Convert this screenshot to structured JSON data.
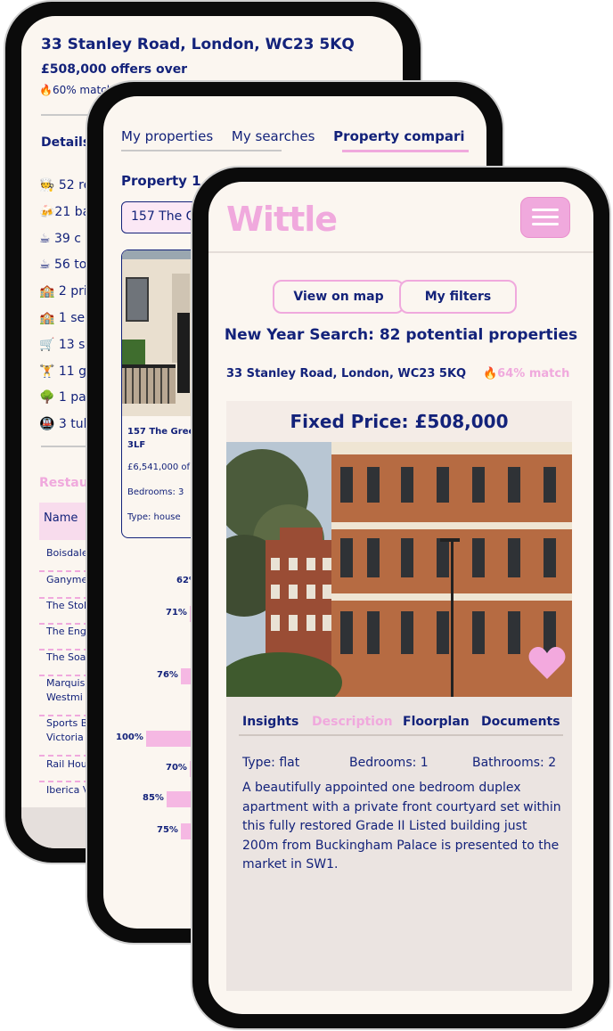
{
  "phone_back": {
    "address": "33 Stanley Road, London, WC23 5KQ",
    "price": "£508,000 offers over",
    "match": "🔥60% match",
    "details_heading": "Details",
    "details_items": [
      "🧑‍🍳 52 re",
      "🍻21 ba",
      "☕ 39 c",
      "☕ 56 to",
      "🏫 2 pri",
      "🏫 1 sec",
      "🛒 13 su",
      "🏋️ 11 gy",
      "🌳 1 pa",
      "🚇 3 tub"
    ],
    "restaurants_heading": "Restau",
    "table_header": "Name",
    "restaurant_rows": [
      "Boisdale",
      "Ganyme",
      "The Stok",
      "The Eng",
      "The Soa",
      "Marquis",
      "Westmi",
      "Sports B",
      "Victoria",
      "Rail Hou",
      "Iberica V"
    ]
  },
  "phone_middle": {
    "tabs": [
      "My properties",
      "My searches",
      "Property compari"
    ],
    "property_label": "Property 1",
    "property_select": "157 The G",
    "card": {
      "title": "157 The Green",
      "title_line2": "3LF",
      "price": "£6,541,000 of",
      "bedrooms": "Bedrooms: 3",
      "type": "Type: house"
    },
    "bars": [
      {
        "label": "62%",
        "value": 62
      },
      {
        "label": "71%",
        "value": 71
      },
      {
        "label": "76%",
        "value": 76
      },
      {
        "label": "100%",
        "value": 100
      },
      {
        "label": "70%",
        "value": 70
      },
      {
        "label": "85%",
        "value": 85
      },
      {
        "label": "75%",
        "value": 75
      }
    ]
  },
  "phone_front": {
    "logo": "Wittle",
    "buttons": {
      "map": "View on map",
      "filters": "My filters"
    },
    "search_title": "New Year Search: 82 potential properties",
    "address": "33 Stanley Road, London, WC23 5KQ",
    "match": "🔥64% match",
    "price_banner": "Fixed Price: £508,000",
    "tabs": [
      "Insights",
      "Description",
      "Floorplan",
      "Documents"
    ],
    "active_tab": "Description",
    "attributes": {
      "type": "Type: flat",
      "bedrooms": "Bedrooms: 1",
      "bathrooms": "Bathrooms: 2"
    },
    "description": "A beautifully appointed one bedroom duplex apartment with a private front courtyard set within this fully restored Grade II Listed building just 200m from Buckingham Palace is presented to the market in SW1.",
    "colors": {
      "navy": "#13227a",
      "pink": "#f0a9dd",
      "background": "#fbf6f0"
    }
  }
}
